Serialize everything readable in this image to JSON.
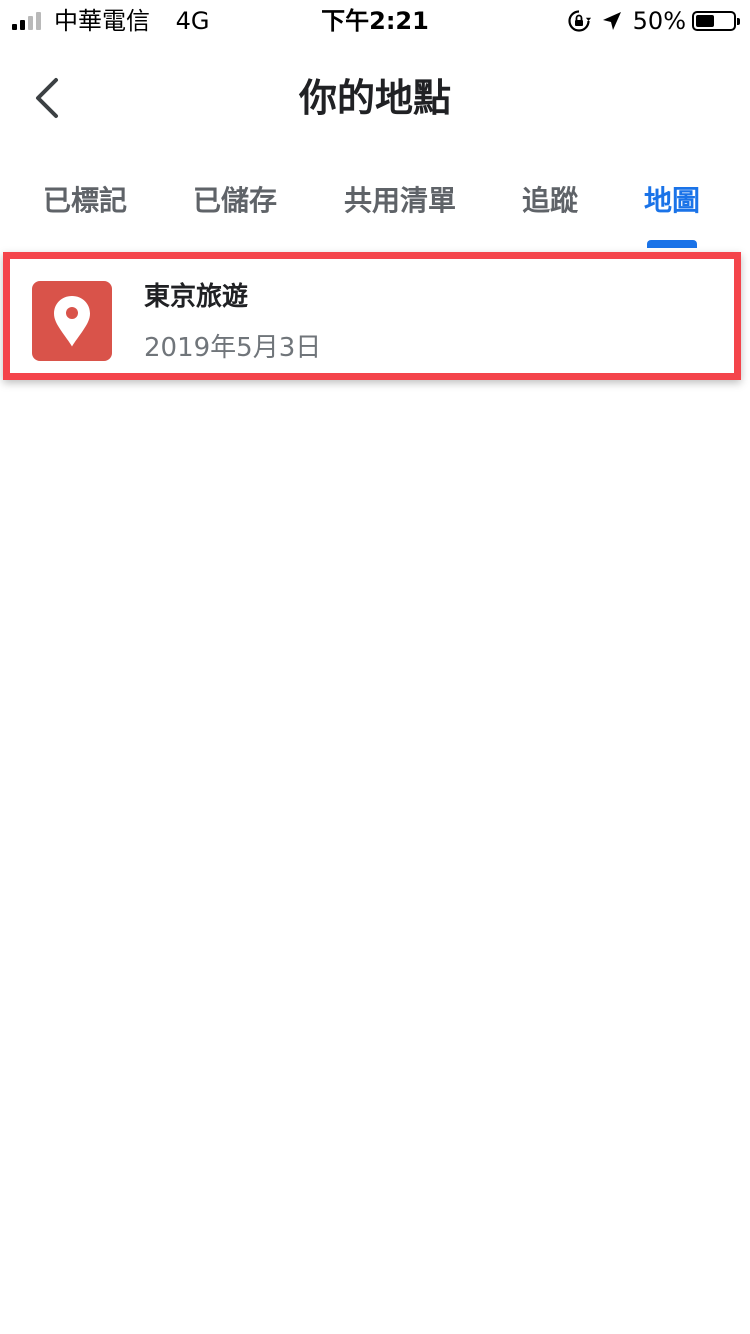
{
  "status_bar": {
    "carrier": "中華電信",
    "network": "4G",
    "time": "下午2:21",
    "battery_percent": "50%",
    "icons": [
      "signal-icon",
      "rotation-lock-icon",
      "location-arrow-icon",
      "battery-icon"
    ],
    "battery_level": 0.5
  },
  "header": {
    "title": "你的地點",
    "back_icon": "chevron-left-icon"
  },
  "tabs": [
    {
      "label": "已標記",
      "active": false
    },
    {
      "label": "已儲存",
      "active": false
    },
    {
      "label": "共用清單",
      "active": false
    },
    {
      "label": "追蹤",
      "active": false
    },
    {
      "label": "地圖",
      "active": true
    }
  ],
  "maps": [
    {
      "title": "東京旅遊",
      "date": "2019年5月3日",
      "icon": "map-pin-icon"
    }
  ],
  "colors": {
    "accent": "#1a73e8",
    "thumbnail": "#d9534a",
    "highlight": "#f4444b",
    "text_primary": "#202124",
    "text_secondary": "#70757a",
    "tab_inactive": "#5f6368"
  }
}
